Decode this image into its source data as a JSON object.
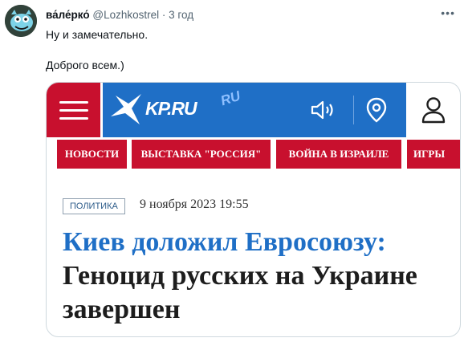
{
  "tweet": {
    "author_name": "ва́ле́рко́",
    "handle": "@Lozhkostrel",
    "separator": "·",
    "time": "3 год",
    "more_icon": "ellipsis-icon",
    "text_line1": "Ну и замечательно.",
    "text_line2": "Доброго всем.)"
  },
  "card": {
    "logo_text": "KP.RU",
    "logo_badge": "RU",
    "icons": [
      "menu-icon",
      "bird-logo-icon",
      "sound-icon",
      "location-pin-icon",
      "user-icon"
    ],
    "nav": [
      {
        "label": "НОВОСТИ"
      },
      {
        "label": "ВЫСТАВКА \"РОССИЯ\""
      },
      {
        "label": "ВОЙНА В ИЗРАИЛЕ"
      },
      {
        "label": "ИГРЫ"
      }
    ],
    "rubric": "ПОЛИТИКА",
    "date": "9 ноября 2023 19:55",
    "headline_blue": "Киев доложил Евросоюзу:",
    "headline_black": "Геноцид русских на Украине завершен",
    "colors": {
      "red": "#c8102e",
      "blue": "#1f6fc6"
    }
  }
}
